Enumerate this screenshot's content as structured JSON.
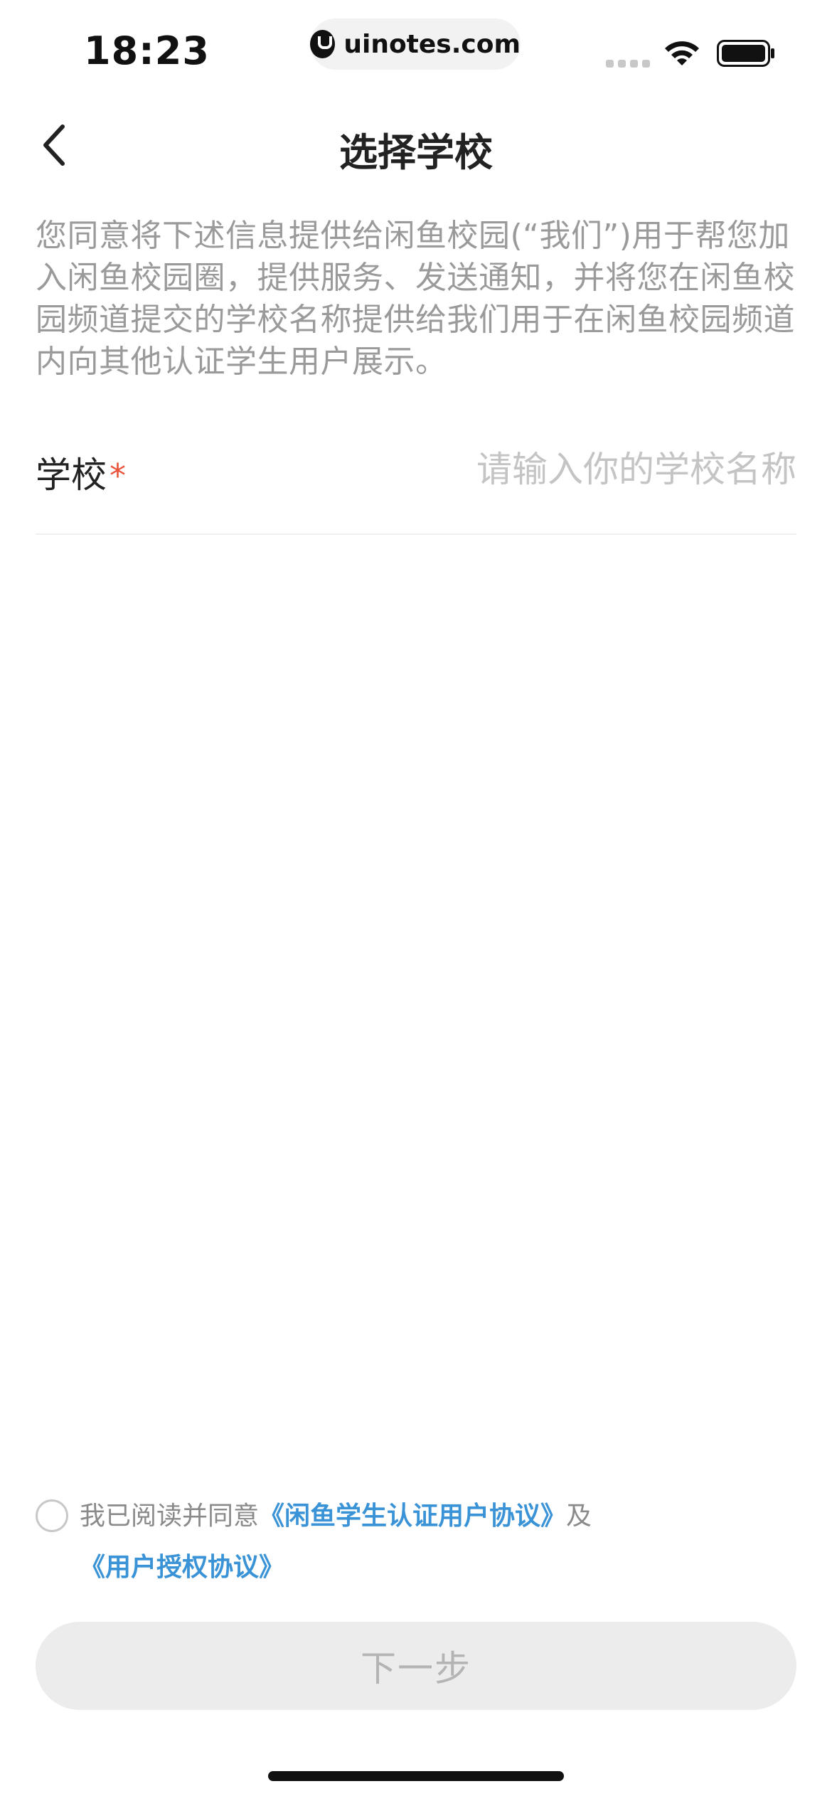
{
  "status_bar": {
    "time": "18:23",
    "url": "uinotes.com",
    "signal_icon": "cellular-signal-icon",
    "wifi_icon": "wifi-icon",
    "battery_icon": "battery-icon"
  },
  "nav": {
    "back_icon": "chevron-left-icon",
    "title": "选择学校"
  },
  "notice": "您同意将下述信息提供给闲鱼校园(“我们”)用于帮您加入闲鱼校园圈，提供服务、发送通知，并将您在闲鱼校园频道提交的学校名称提供给我们用于在闲鱼校园频道内向其他认证学生用户展示。",
  "form": {
    "school_label": "学校",
    "required_mark": "*",
    "school_value": "",
    "school_placeholder": "请输入你的学校名称"
  },
  "agreement": {
    "checked": false,
    "prefix": "我已阅读并同意",
    "link_1": "《闲鱼学生认证用户协议》",
    "conjunction": "及",
    "link_2": "《用户授权协议》"
  },
  "next_button": {
    "label": "下一步",
    "enabled": false
  },
  "colors": {
    "accent_link": "#3a93d6",
    "required": "#e8543a",
    "disabled_button_bg": "#ececec",
    "disabled_button_text": "#b4b4b4",
    "muted_text": "#9a9a9a"
  }
}
